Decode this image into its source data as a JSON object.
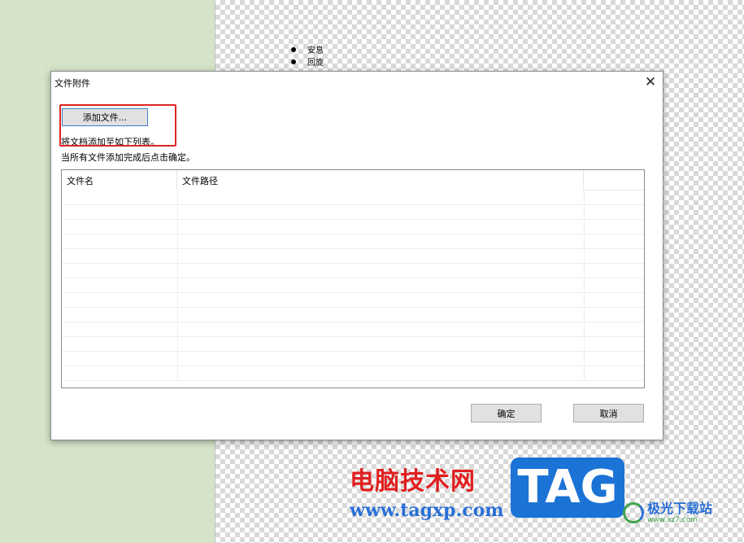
{
  "background_doc": {
    "bullets": [
      "安息",
      "回旋"
    ]
  },
  "dialog": {
    "title": "文件附件",
    "close_glyph": "✕",
    "add_button_label": "添加文件...",
    "hint_line1": "将文档添加至如下列表。",
    "hint_line2": "当所有文件添加完成后点击确定。",
    "table": {
      "columns": [
        "文件名",
        "文件路径",
        ""
      ],
      "rows": []
    },
    "ok_label": "确定",
    "cancel_label": "取消"
  },
  "watermarks": {
    "cn_text": "电脑技术网",
    "url": "www.tagxp.com",
    "tag_logo": "TAG",
    "site_name": "极光下载站",
    "site_url": "www.xz7.com"
  },
  "colors": {
    "highlight": "#e02424",
    "page_bg": "#d5e3c8",
    "tag_blue": "#1c73d6"
  }
}
